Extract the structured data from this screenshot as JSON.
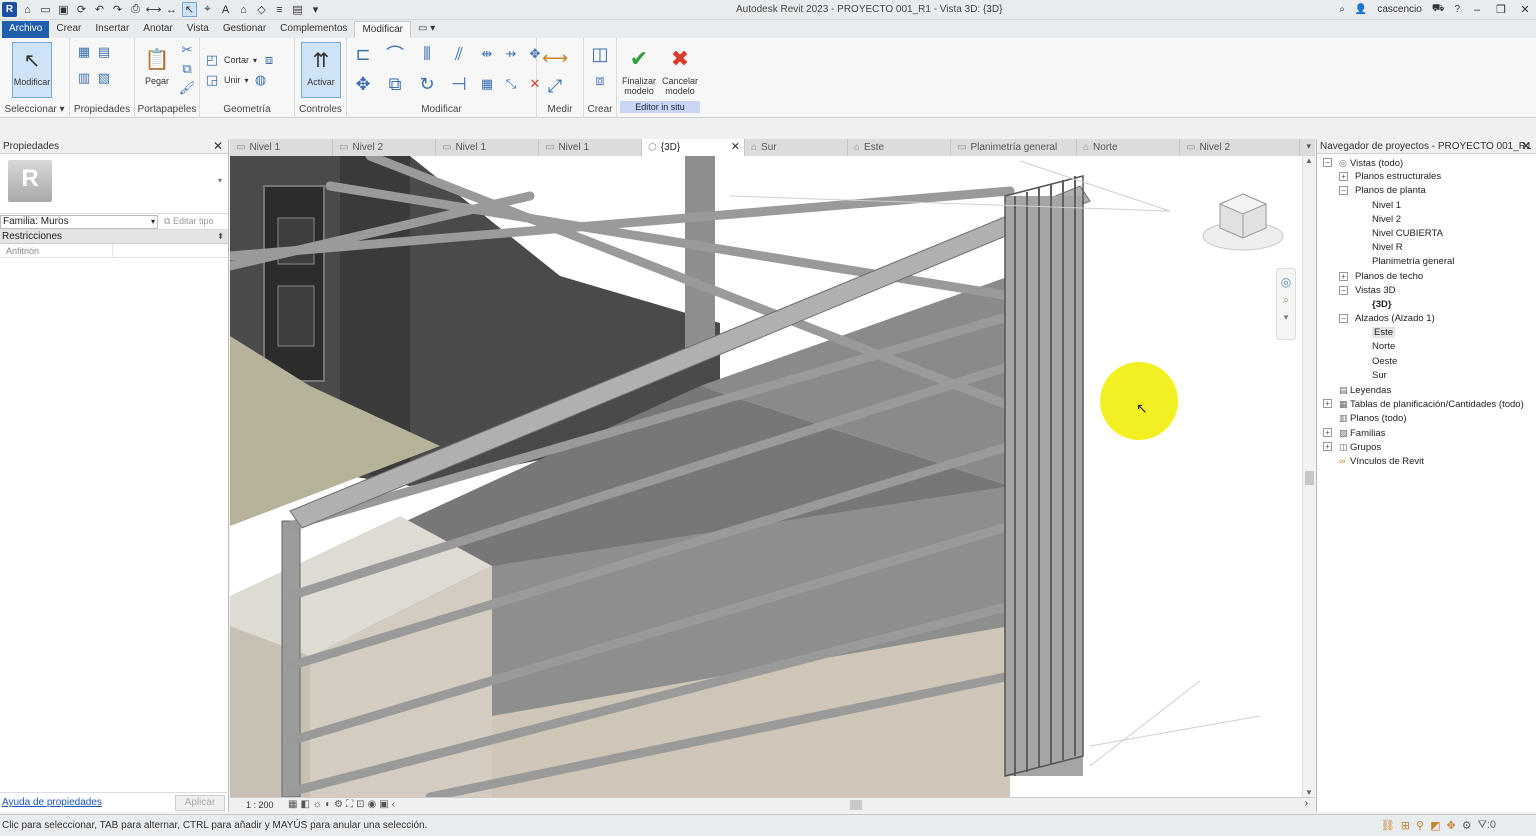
{
  "titlebar": {
    "title": "Autodesk Revit 2023 - PROYECTO 001_R1 - Vista 3D: {3D}",
    "user": "cascencio",
    "logo": "R"
  },
  "ribbon_tabs": [
    "Archivo",
    "Crear",
    "Insertar",
    "Anotar",
    "Vista",
    "Gestionar",
    "Complementos",
    "Modificar"
  ],
  "ribbon": {
    "modificar_label": "Modificar",
    "seleccionar_label": "Seleccionar ▾",
    "propiedades_label": "Propiedades",
    "pegar_label": "Pegar",
    "portapapeles_label": "Portapapeles",
    "cortar_label": "Cortar",
    "unir_label": "Unir",
    "geometria_label": "Geometría",
    "activar_label": "Activar",
    "controles_label": "Controles",
    "modificar_group_label": "Modificar",
    "medir_label": "Medir",
    "crear_label": "Crear",
    "finalizar_label1": "Finalizar",
    "finalizar_label2": "modelo",
    "cancelar_label1": "Cancelar",
    "cancelar_label2": "modelo",
    "editor_label": "Editor in situ"
  },
  "properties": {
    "header": "Propiedades",
    "family": "Familia: Muros",
    "edit_type": "Editar tipo",
    "section": "Restricciones",
    "row_key": "Anfitrión",
    "help": "Ayuda de propiedades",
    "apply": "Aplicar"
  },
  "view_tabs": [
    {
      "label": "Nivel 1"
    },
    {
      "label": "Nivel 2"
    },
    {
      "label": "Nivel 1"
    },
    {
      "label": "Nivel 1"
    },
    {
      "label": "{3D}"
    },
    {
      "label": "Sur"
    },
    {
      "label": "Este"
    },
    {
      "label": "Planimetría general"
    },
    {
      "label": "Norte"
    },
    {
      "label": "Nivel 2"
    }
  ],
  "view_control": {
    "scale": "1 : 200"
  },
  "browser": {
    "header": "Navegador de proyectos - PROYECTO 001_R1",
    "nodes": [
      {
        "label": "Vistas (todo)"
      },
      {
        "label": "Planos estructurales"
      },
      {
        "label": "Planos de planta"
      },
      {
        "label": "Nivel 1"
      },
      {
        "label": "Nivel 2"
      },
      {
        "label": "Nivel CUBIERTA"
      },
      {
        "label": "Nivel R"
      },
      {
        "label": "Planimetría general"
      },
      {
        "label": "Planos de techo"
      },
      {
        "label": "Vistas 3D"
      },
      {
        "label": "{3D}"
      },
      {
        "label": "Alzados (Alzado 1)"
      },
      {
        "label": "Este"
      },
      {
        "label": "Norte"
      },
      {
        "label": "Oeste"
      },
      {
        "label": "Sur"
      },
      {
        "label": "Leyendas"
      },
      {
        "label": "Tablas de planificación/Cantidades (todo)"
      },
      {
        "label": "Planos (todo)"
      },
      {
        "label": "Familias"
      },
      {
        "label": "Grupos"
      },
      {
        "label": "Vínculos de Revit"
      }
    ]
  },
  "status": {
    "text": "Clic para seleccionar, TAB para alternar, CTRL para añadir y MAYÚS para anular una selección.",
    "filter_count": ":0"
  },
  "colors": {
    "accent": "#1f5fae",
    "finalizar": "#2e9e3e",
    "cancelar": "#d83a2b",
    "highlight": "#f3f021"
  }
}
